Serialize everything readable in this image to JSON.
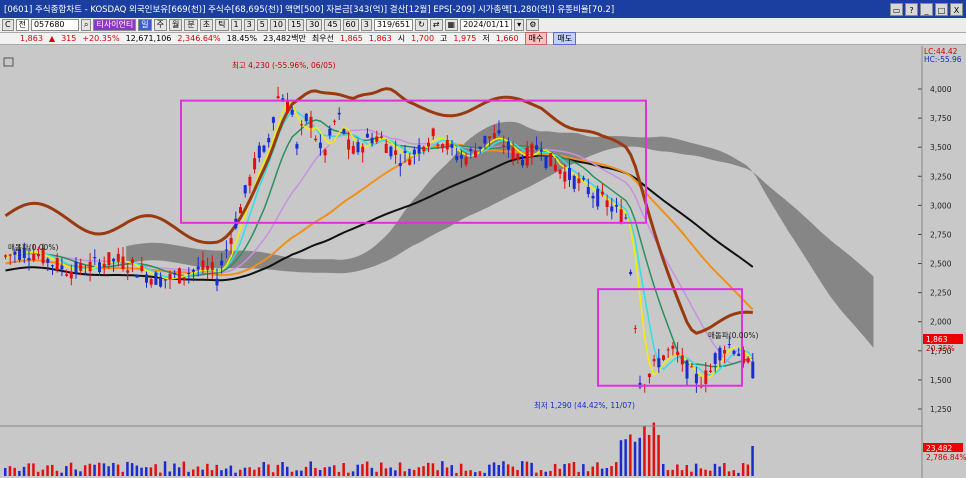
{
  "window": {
    "title": "[0601] 주식종합차트 - KOSDAQ 외국인보유[669(천)] 주식수[68,695(천)] 액면[500] 자본금[343(억)] 결산[12월] EPS[-209] 시가총액[1,280(억)] 유통비율[70.2]",
    "buttons": [
      "▭",
      "?",
      "_",
      "□",
      "X"
    ]
  },
  "toolbar": {
    "tabs": [
      "C",
      "전"
    ],
    "code": "057680",
    "search_icon": "magnifier-icon",
    "name": "티사이언티",
    "period_buttons": [
      "일",
      "주",
      "월",
      "분",
      "초",
      "틱"
    ],
    "minute_buttons": [
      "1",
      "3",
      "5",
      "10",
      "15",
      "30",
      "45",
      "60"
    ],
    "more": "3",
    "count": "319",
    "count_total": "651",
    "date": "2024/01/11"
  },
  "quote": {
    "price": "1,863",
    "change": "315",
    "change_pct": "+20.35%",
    "volume": "12,671,106",
    "volume_ratio": "2,346.64%",
    "turnover": "18.45%",
    "amount": "23,482백만",
    "label_pref": "최우선",
    "pref_ask": "1,865",
    "pref_bid": "1,863",
    "open_label": "시",
    "open": "1,700",
    "high_label": "고",
    "high": "1,975",
    "low_label": "저",
    "low": "1,660",
    "buy_label": "매수",
    "sell_label": "매도"
  },
  "chart": {
    "high_label": "최고 4,230 (-55.96%, 06/05)",
    "low_label": "최저 1,290 (44.42%, 11/07)",
    "lc_label": "LC:44.42",
    "hc_label": "HC:-55.96",
    "price_labels": [
      "4,000",
      "3,750",
      "3,500",
      "3,250",
      "3,000",
      "2,750",
      "2,500",
      "2,250",
      "2,000",
      "1,750",
      "1,500",
      "1,250"
    ],
    "price_values": [
      4000,
      3750,
      3500,
      3250,
      3000,
      2750,
      2500,
      2250,
      2000,
      1750,
      1500,
      1250
    ],
    "current_price": "1,863",
    "current_pct": "20.35%",
    "left_marker": "매돌파(0.00%)",
    "right_marker": "매돌파(0.00%)",
    "volume_current": "23,482",
    "volume_pct": "2,786.84%",
    "colors": {
      "bg": "#c8c8c8",
      "up": "#e01010",
      "down": "#1a2cd0",
      "box": "#e030e0",
      "bollinger": "#9a3a10",
      "ma_long": "#111111",
      "ma_orange": "#f0901a",
      "ma_violet": "#c890e0",
      "ma_green": "#2a9060",
      "ma_cyan": "#30e0e0",
      "ma_yellow": "#f0f000",
      "cloud": "#7a7a7a"
    }
  }
}
